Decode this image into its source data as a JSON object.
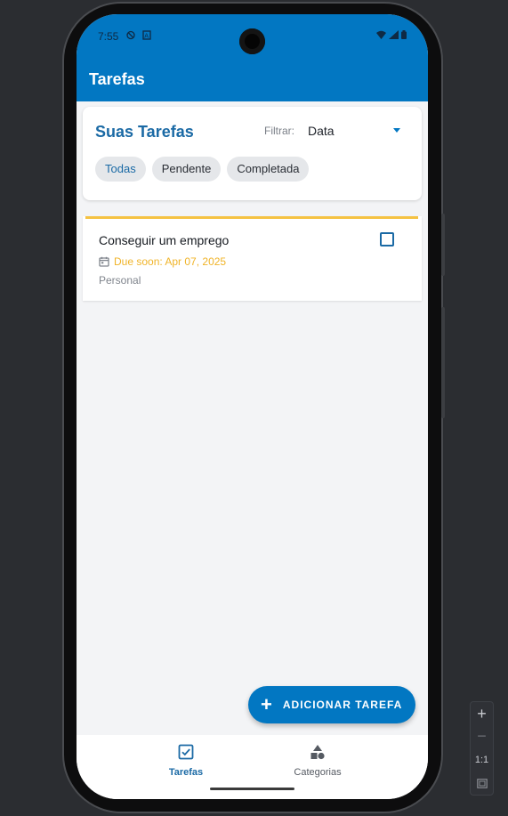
{
  "status_bar": {
    "time": "7:55"
  },
  "app_bar": {
    "title": "Tarefas"
  },
  "filter_card": {
    "section_title": "Suas Tarefas",
    "filter_label": "Filtrar:",
    "filter_value": "Data",
    "chips": [
      {
        "label": "Todas",
        "selected": true
      },
      {
        "label": "Pendente",
        "selected": false
      },
      {
        "label": "Completada",
        "selected": false
      }
    ]
  },
  "tasks": [
    {
      "title": "Conseguir um emprego",
      "due": "Due soon: Apr 07, 2025",
      "category": "Personal",
      "completed": false,
      "accent_color": "#f5c242"
    }
  ],
  "fab": {
    "label": "ADICIONAR TAREFA"
  },
  "bottom_nav": {
    "items": [
      {
        "label": "Tarefas",
        "icon": "checkbox-icon",
        "active": true
      },
      {
        "label": "Categorias",
        "icon": "shapes-icon",
        "active": false
      }
    ]
  },
  "emulator_zoom": {
    "zoom_in": "+",
    "zoom_out": "−",
    "ratio": "1:1"
  },
  "colors": {
    "primary": "#0277c2",
    "title_blue": "#1b6aa5",
    "due_soon": "#f0b429",
    "background": "#f3f4f6"
  }
}
